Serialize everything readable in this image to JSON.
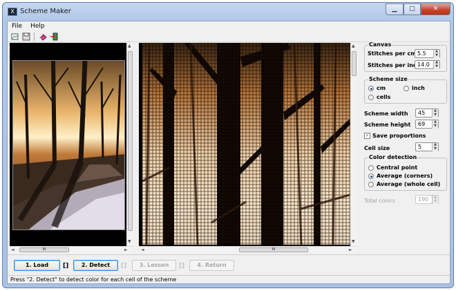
{
  "window": {
    "title": "Scheme Maker",
    "icon_glyph": "X"
  },
  "caption_buttons": {
    "minimize": "▁",
    "maximize": "□",
    "close": "✕"
  },
  "menu": [
    "File",
    "Help"
  ],
  "toolbar_icons": [
    "open-image-icon",
    "save-icon",
    "eraser-icon",
    "exit-icon"
  ],
  "canvas": {
    "title": "Canvas",
    "stitches_per_cm_label": "Stitches per cm",
    "stitches_per_cm": "5.5",
    "stitches_per_inch_label": "Stitches per inch",
    "stitches_per_inch": "14.0"
  },
  "scheme_size": {
    "title": "Scheme size",
    "cm": "cm",
    "inch": "inch",
    "cells": "cells",
    "selected": "cm"
  },
  "scheme_width_label": "Scheme width",
  "scheme_width": "45",
  "scheme_height_label": "Scheme height",
  "scheme_height": "69",
  "save_proportions_label": "Save proportions",
  "save_proportions": true,
  "cell_size_label": "Cell size",
  "cell_size": "5",
  "color_detection": {
    "title": "Color detection",
    "central_point": "Central point",
    "average_corners": "Average (corners)",
    "average_whole": "Average (whole cell)",
    "selected": "Average (corners)"
  },
  "total_colors_label": "Total colors",
  "total_colors": "190",
  "steps": {
    "load": "1. Load",
    "detect": "2. Detect",
    "lessen": "3. Lessen",
    "return": "4. Return",
    "separator": "[]"
  },
  "status": "Press \"2. Detect\" to detect color for each cell of the scheme",
  "scroll_grip": "III",
  "arrows": {
    "up": "▲",
    "down": "▼",
    "left": "◄",
    "right": "►"
  },
  "colors": {
    "accent": "#3a8ad8",
    "titlebar": "#b0c8e8",
    "close": "#c7432b"
  }
}
